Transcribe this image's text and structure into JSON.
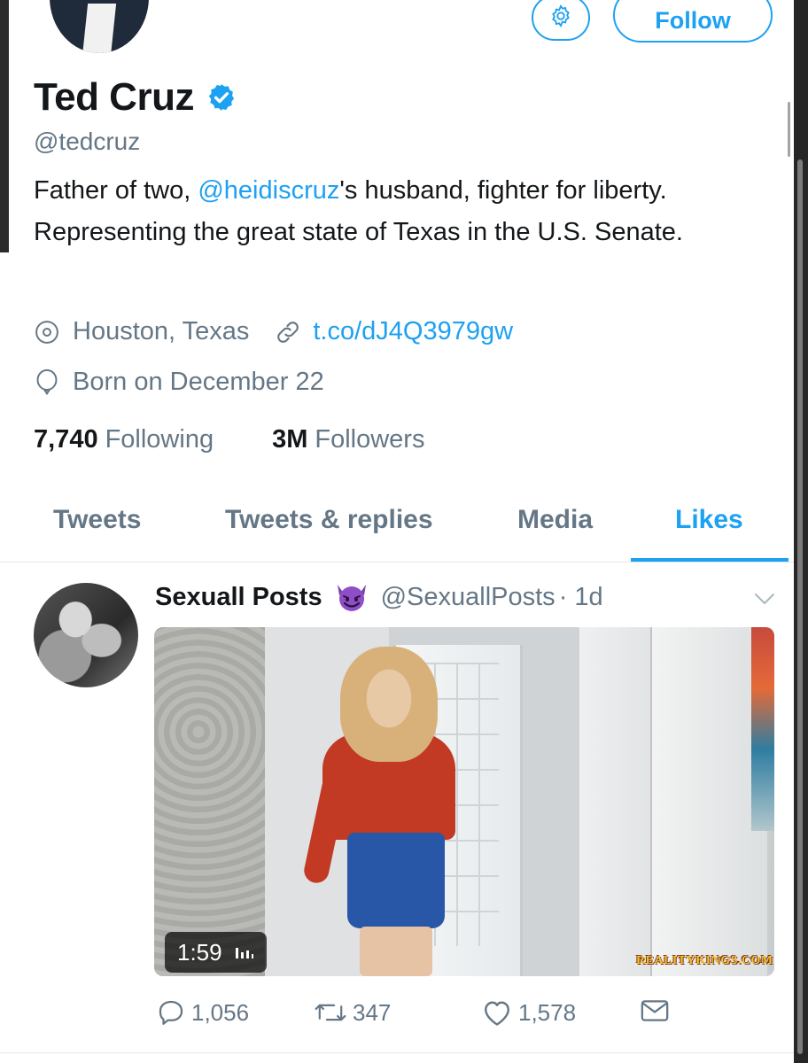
{
  "profile": {
    "name": "Ted Cruz",
    "handle": "@tedcruz",
    "verified": true,
    "follow_label": "Follow",
    "bio_before": "Father of two, ",
    "bio_mention": "@heidiscruz",
    "bio_after": "'s husband, fighter for liberty. Representing the great state of Texas in the U.S. Senate.",
    "location": "Houston, Texas",
    "website": "t.co/dJ4Q3979gw",
    "birthday": "Born on December 22",
    "following_count": "7,740",
    "following_label": "Following",
    "followers_count": "3M",
    "followers_label": "Followers"
  },
  "tabs": [
    {
      "label": "Tweets",
      "active": false
    },
    {
      "label": "Tweets & replies",
      "active": false
    },
    {
      "label": "Media",
      "active": false
    },
    {
      "label": "Likes",
      "active": true
    }
  ],
  "tweet": {
    "author_name": "Sexuall Posts",
    "author_handle": "@SexuallPosts",
    "time": "· 1d",
    "video_duration": "1:59",
    "watermark": "REALITYKINGS.COM",
    "replies": "1,056",
    "retweets": "347",
    "likes": "1,578"
  },
  "colors": {
    "accent": "#1da1f2",
    "secondary_text": "#657786",
    "primary_text": "#14171a"
  },
  "icons": {
    "settings": "gear-icon",
    "verified": "verified-badge-icon",
    "location": "location-pin-icon",
    "link": "link-icon",
    "birthday": "balloon-icon",
    "emoji": "smiling-devil-icon",
    "menu": "chevron-down-icon",
    "reply": "reply-icon",
    "retweet": "retweet-icon",
    "like": "heart-icon",
    "dm": "mail-icon"
  }
}
